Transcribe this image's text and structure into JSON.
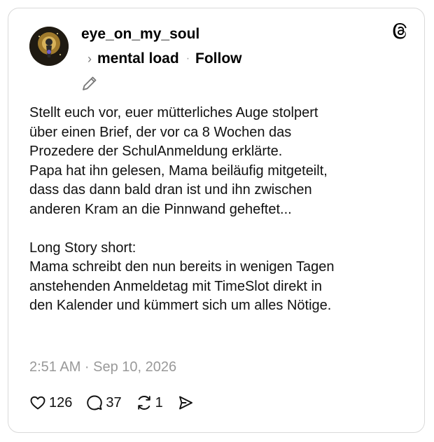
{
  "post": {
    "username": "eye_on_my_soul",
    "topic": "mental load",
    "separator": "·",
    "follow_label": "Follow",
    "body": "Stellt euch vor, euer mütterliches Auge stolpert\nüber einen Brief, der vor ca 8 Wochen das\nProzedere der SchulAnmeldung erklärte.\nPapa hat ihn gelesen, Mama beiläufig mitgeteilt,\ndass das dann bald dran ist und ihn zwischen\nanderen Kram an die Pinnwand geheftet...\n\nLong Story short:\nMama schreibt den nun bereits in wenigen Tagen\nanstehenden Anmeldetag mit TimeSlot direkt in\nden Kalender und kümmert sich um alles Nötige.",
    "timestamp": "2:51 AM · Sep 10, 2026",
    "likes": "126",
    "replies": "37",
    "reposts": "1"
  },
  "icons": {
    "avatar": "avatar-image",
    "logo": "threads-logo-icon",
    "chevron": "chevron-right-icon",
    "pencil": "pencil-icon",
    "like": "heart-icon",
    "reply": "comment-icon",
    "repost": "repost-icon",
    "share": "send-icon"
  },
  "colors": {
    "text": "#111111",
    "muted": "#999999",
    "border": "#d9d9d9"
  }
}
